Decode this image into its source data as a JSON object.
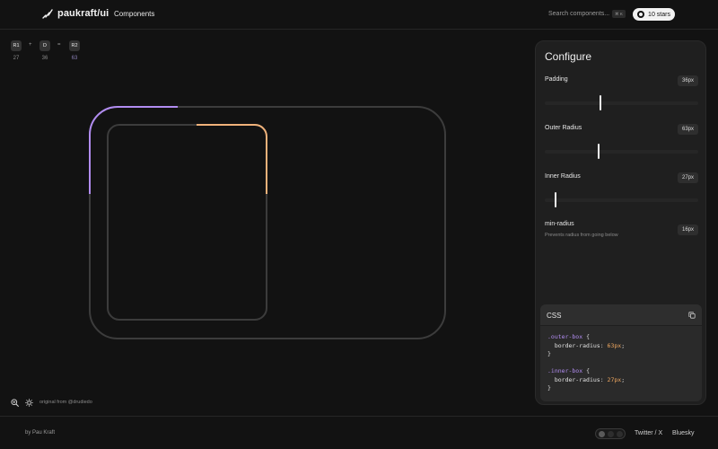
{
  "header": {
    "brand": "paukraft/ui",
    "nav_components": "Components",
    "search_label": "Search components...",
    "search_shortcut": "⌘ K",
    "github_stars": "10 stars",
    "icons": [
      "logo-icon",
      "github-icon"
    ]
  },
  "formula": {
    "r1_label": "R1",
    "plus": "+",
    "d_label": "D",
    "equals": "=",
    "r2_label": "R2",
    "r1_value": "27",
    "d_value": "36",
    "r2_value": "63"
  },
  "preview": {
    "credit": "original from @drudiedo",
    "icons": [
      "zoom-icon",
      "sun-icon"
    ],
    "outer_color": "#b18cf0",
    "inner_color": "#f0b27a",
    "border_color": "#3c3c3c"
  },
  "configure": {
    "title": "Configure",
    "padding_label": "Padding",
    "padding_value": "36px",
    "padding_level": 0.36,
    "outer_radius_label": "Outer Radius",
    "outer_radius_value": "63px",
    "outer_radius_level": 0.35,
    "inner_radius_label": "Inner Radius",
    "inner_radius_value": "27px",
    "inner_radius_level": 0.07,
    "min_radius_label": "min-radius",
    "min_radius_desc": "Prevents radius from going below",
    "min_radius_value": "16px"
  },
  "css_panel": {
    "title": "CSS",
    "outer_selector": ".outer-box",
    "outer_prop": "border-radius",
    "outer_val": "63px",
    "inner_selector": ".inner-box",
    "inner_prop": "border-radius",
    "inner_val": "27px",
    "open_brace": "{",
    "close_brace": "}"
  },
  "footer": {
    "byline": "by Pau Kraft",
    "twitter": "Twitter / X",
    "bluesky": "Bluesky"
  }
}
